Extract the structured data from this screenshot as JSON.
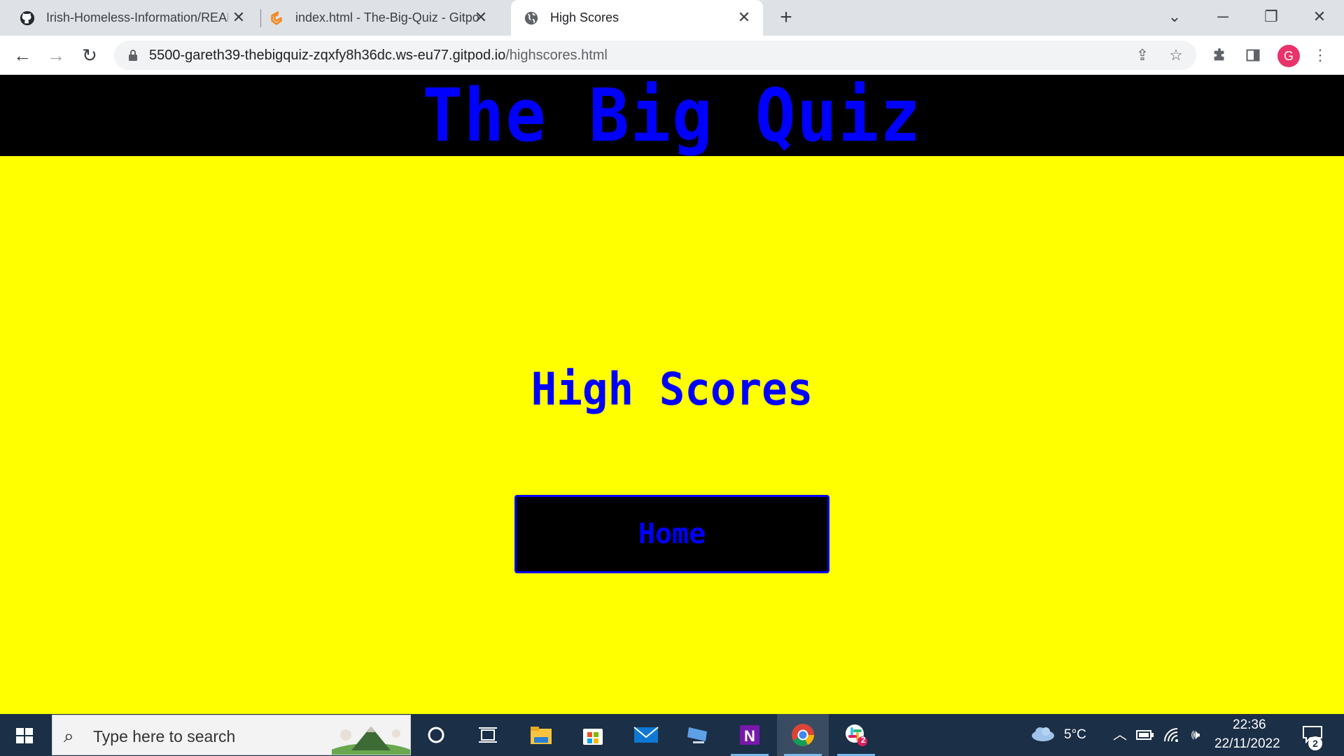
{
  "browser": {
    "tabs": [
      {
        "title": "Irish-Homeless-Information/README",
        "favicon": "github-icon"
      },
      {
        "title": "index.html - The-Big-Quiz - Gitpod",
        "favicon": "gitpod-icon"
      },
      {
        "title": "High Scores",
        "favicon": "globe-icon",
        "active": true
      }
    ],
    "url_host": "5500-gareth39-thebigquiz-zqxfy8h36dc.ws-eu77.gitpod.io",
    "url_path": "/highscores.html",
    "profile_initial": "G"
  },
  "page": {
    "site_title": "The Big Quiz",
    "heading": "High Scores",
    "home_button": "Home",
    "colors": {
      "background": "#ffff00",
      "header": "#000000",
      "accent": "#0000ff"
    }
  },
  "taskbar": {
    "search_placeholder": "Type here to search",
    "weather": "5°C",
    "time": "22:36",
    "date": "22/11/2022",
    "notification_count": "2",
    "slack_badge": "2"
  }
}
